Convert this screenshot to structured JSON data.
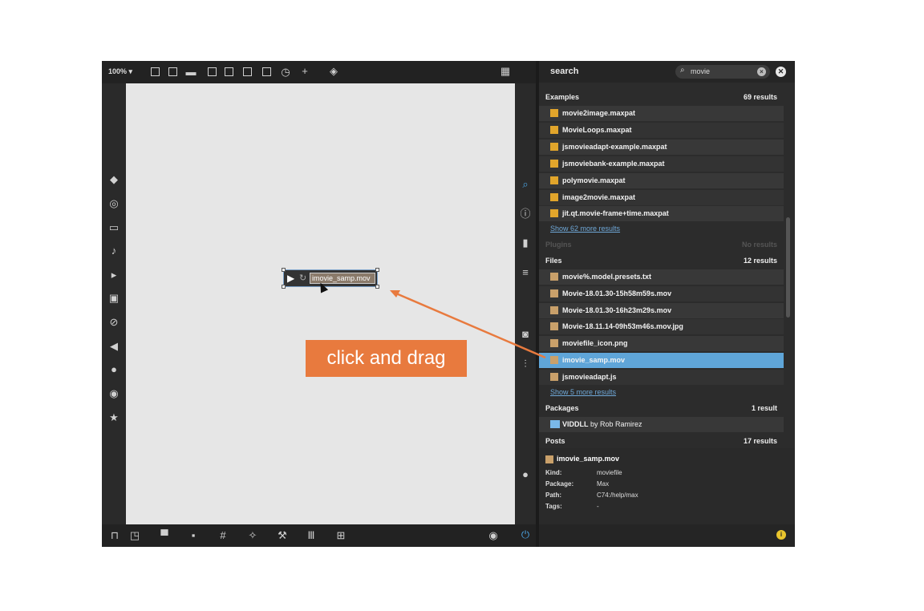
{
  "toolbar": {
    "zoom": "100%",
    "zoom_caret": "▾"
  },
  "canvas_object": {
    "filename": "imovie_samp.mov"
  },
  "search": {
    "label": "search",
    "query": "movie"
  },
  "sections": {
    "examples": {
      "title": "Examples",
      "count": "69 results",
      "items": [
        "movie2image.maxpat",
        "MovieLoops.maxpat",
        "jsmovieadapt-example.maxpat",
        "jsmoviebank-example.maxpat",
        "polymovie.maxpat",
        "image2movie.maxpat",
        "jit.qt.movie-frame+time.maxpat"
      ],
      "more": "Show 62 more results"
    },
    "plugins": {
      "title": "Plugins",
      "count": "No results"
    },
    "files": {
      "title": "Files",
      "count": "12 results",
      "items": [
        "movie%.model.presets.txt",
        "Movie-18.01.30-15h58m59s.mov",
        "Movie-18.01.30-16h23m29s.mov",
        "Movie-18.11.14-09h53m46s.mov.jpg",
        "moviefile_icon.png",
        "imovie_samp.mov",
        "jsmovieadapt.js"
      ],
      "more": "Show 5 more results"
    },
    "packages": {
      "title": "Packages",
      "count": "1 result",
      "item_name": "VIDDLL",
      "item_author": " by Rob Ramirez"
    },
    "posts": {
      "title": "Posts",
      "count": "17 results"
    }
  },
  "detail": {
    "name": "imovie_samp.mov",
    "kind_label": "Kind:",
    "kind": "moviefile",
    "package_label": "Package:",
    "package": "Max",
    "path_label": "Path:",
    "path": "C74:/help/max",
    "tags_label": "Tags:",
    "tags": "-"
  },
  "annotation": {
    "text": "click and drag",
    "color": "#e87a3e"
  },
  "colors": {
    "selection": "#5fa5d8",
    "file_icon": "#e1a52b",
    "link": "#6fa8d8"
  }
}
